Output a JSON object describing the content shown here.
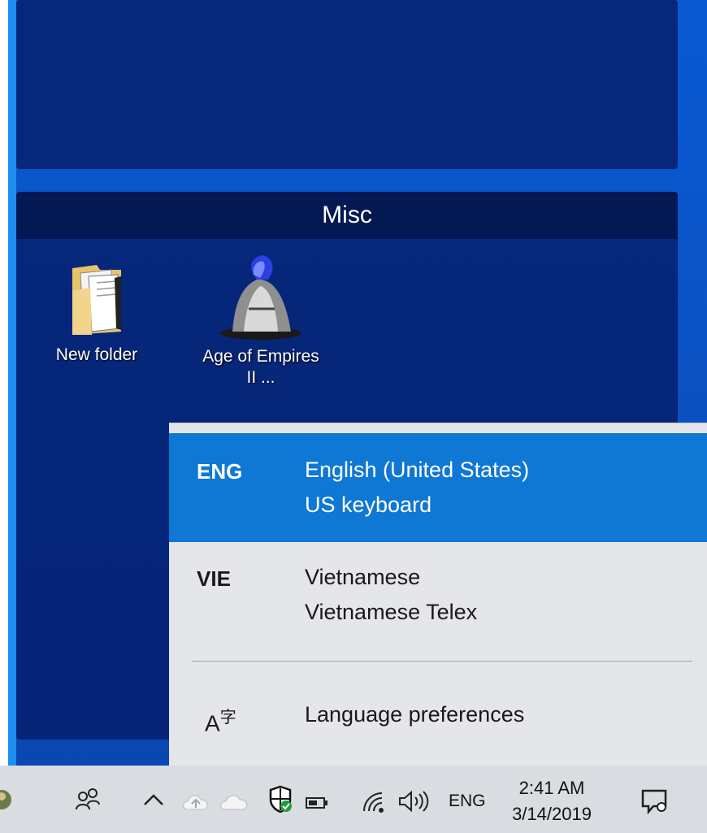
{
  "desktop": {
    "fence_title": "Misc",
    "icons": [
      {
        "label": "New folder",
        "icon": "folder-icon"
      },
      {
        "label": "Age of Empires II ...",
        "icon": "age-of-empires-icon"
      }
    ]
  },
  "language_panel": {
    "items": [
      {
        "code": "ENG",
        "language": "English (United States)",
        "keyboard": "US keyboard",
        "selected": true
      },
      {
        "code": "VIE",
        "language": "Vietnamese",
        "keyboard": "Vietnamese Telex",
        "selected": false
      }
    ],
    "preferences_label": "Language preferences",
    "preferences_icon": "language-icon",
    "colors": {
      "selected": "#0f78d4",
      "panel": "#e4e6ea"
    }
  },
  "taskbar": {
    "input_indicator": "ENG",
    "time": "2:41 AM",
    "date": "3/14/2019",
    "icons": [
      "people-icon",
      "chevron-up-icon",
      "cloud-upload-icon",
      "onedrive-icon",
      "defender-icon",
      "battery-icon",
      "wifi-icon",
      "volume-icon",
      "notification-icon"
    ]
  }
}
